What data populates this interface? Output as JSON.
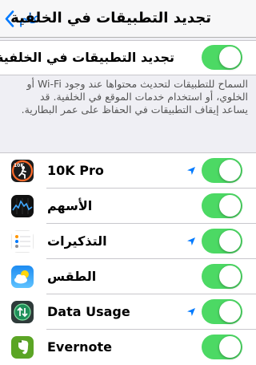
{
  "nav": {
    "title": "تجديد التطبيقات في الخلفية",
    "back_label": "عام"
  },
  "master": {
    "label": "تجديد التطبيقات في الخلفية",
    "enabled": true
  },
  "footer": {
    "text": "السماح للتطبيقات لتحديث محتواها عند وجود Wi-Fi أو الخلوي، أو استخدام خدمات الموقع في الخلفية. قد يساعد إيقاف التطبيقات في الحفاظ على عمر البطارية."
  },
  "apps": [
    {
      "name": "10K Pro",
      "icon": "10k-pro-icon",
      "location": true,
      "enabled": true
    },
    {
      "name": "الأسهم",
      "icon": "stocks-icon",
      "location": false,
      "enabled": true
    },
    {
      "name": "التذكيرات",
      "icon": "reminders-icon",
      "location": true,
      "enabled": true
    },
    {
      "name": "الطقس",
      "icon": "weather-icon",
      "location": false,
      "enabled": true
    },
    {
      "name": "Data Usage",
      "icon": "data-usage-icon",
      "location": true,
      "enabled": true
    },
    {
      "name": "Evernote",
      "icon": "evernote-icon",
      "location": false,
      "enabled": true
    }
  ],
  "colors": {
    "accent": "#007aff",
    "toggle_on": "#4cd964",
    "background": "#efeff4"
  }
}
